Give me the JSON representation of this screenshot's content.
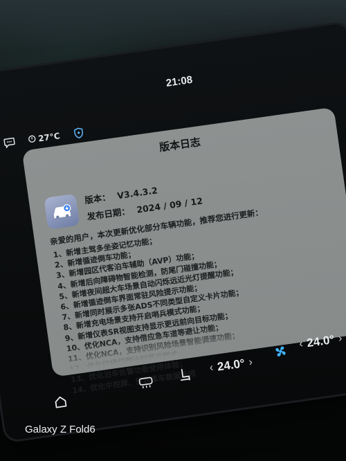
{
  "status_bar": {
    "time": "21:08",
    "temperature": "27°C"
  },
  "dialog": {
    "title": "版本日志",
    "version_label": "版本：",
    "version_value": "V3.4.3.2",
    "date_label": "发布日期：",
    "date_value": "2024 / 09 / 12",
    "intro": "亲爱的用户，本次更新优化部分车辆功能，推荐您进行更新：",
    "notes": [
      "1、新增主驾多坐姿记忆功能；",
      "2、新增循迹倒车功能；",
      "3、新增园区代客泊车辅助（AVP）功能；",
      "4、新增后向障碍物智能检测，防尾门碰撞功能；",
      "5、新增夜间超大车场景自动闪烁远近光灯提醒功能；",
      "6、新增循迹倒车界面常驻风险提示功能；",
      "7、新增同时展示多张ADS不同类型自定义卡片功能；",
      "8、新增充电场景支持开启哨兵模式功能；",
      "9、新增仪表SR视图支持显示更远前向目标功能；",
      "10、优化NCA，支持借应急车道等避让功能；",
      "11、优化NCA，支持识别风险场景智能调速功能；",
      "12、优化红绿灯倒计时显示样式；",
      "13、优化泊车告警功能使用体验；",
      "14、优化中控屏、仪表库车数据示项"
    ]
  },
  "climate_bar": {
    "temp_left": "24.0°",
    "temp_right": "24.0°"
  },
  "device_watermark": "Galaxy Z Fold6",
  "colors": {
    "card_bg": "#8a8e8d",
    "fan_accent": "#3fb3ff",
    "screen_bg": "#0c0f10"
  }
}
